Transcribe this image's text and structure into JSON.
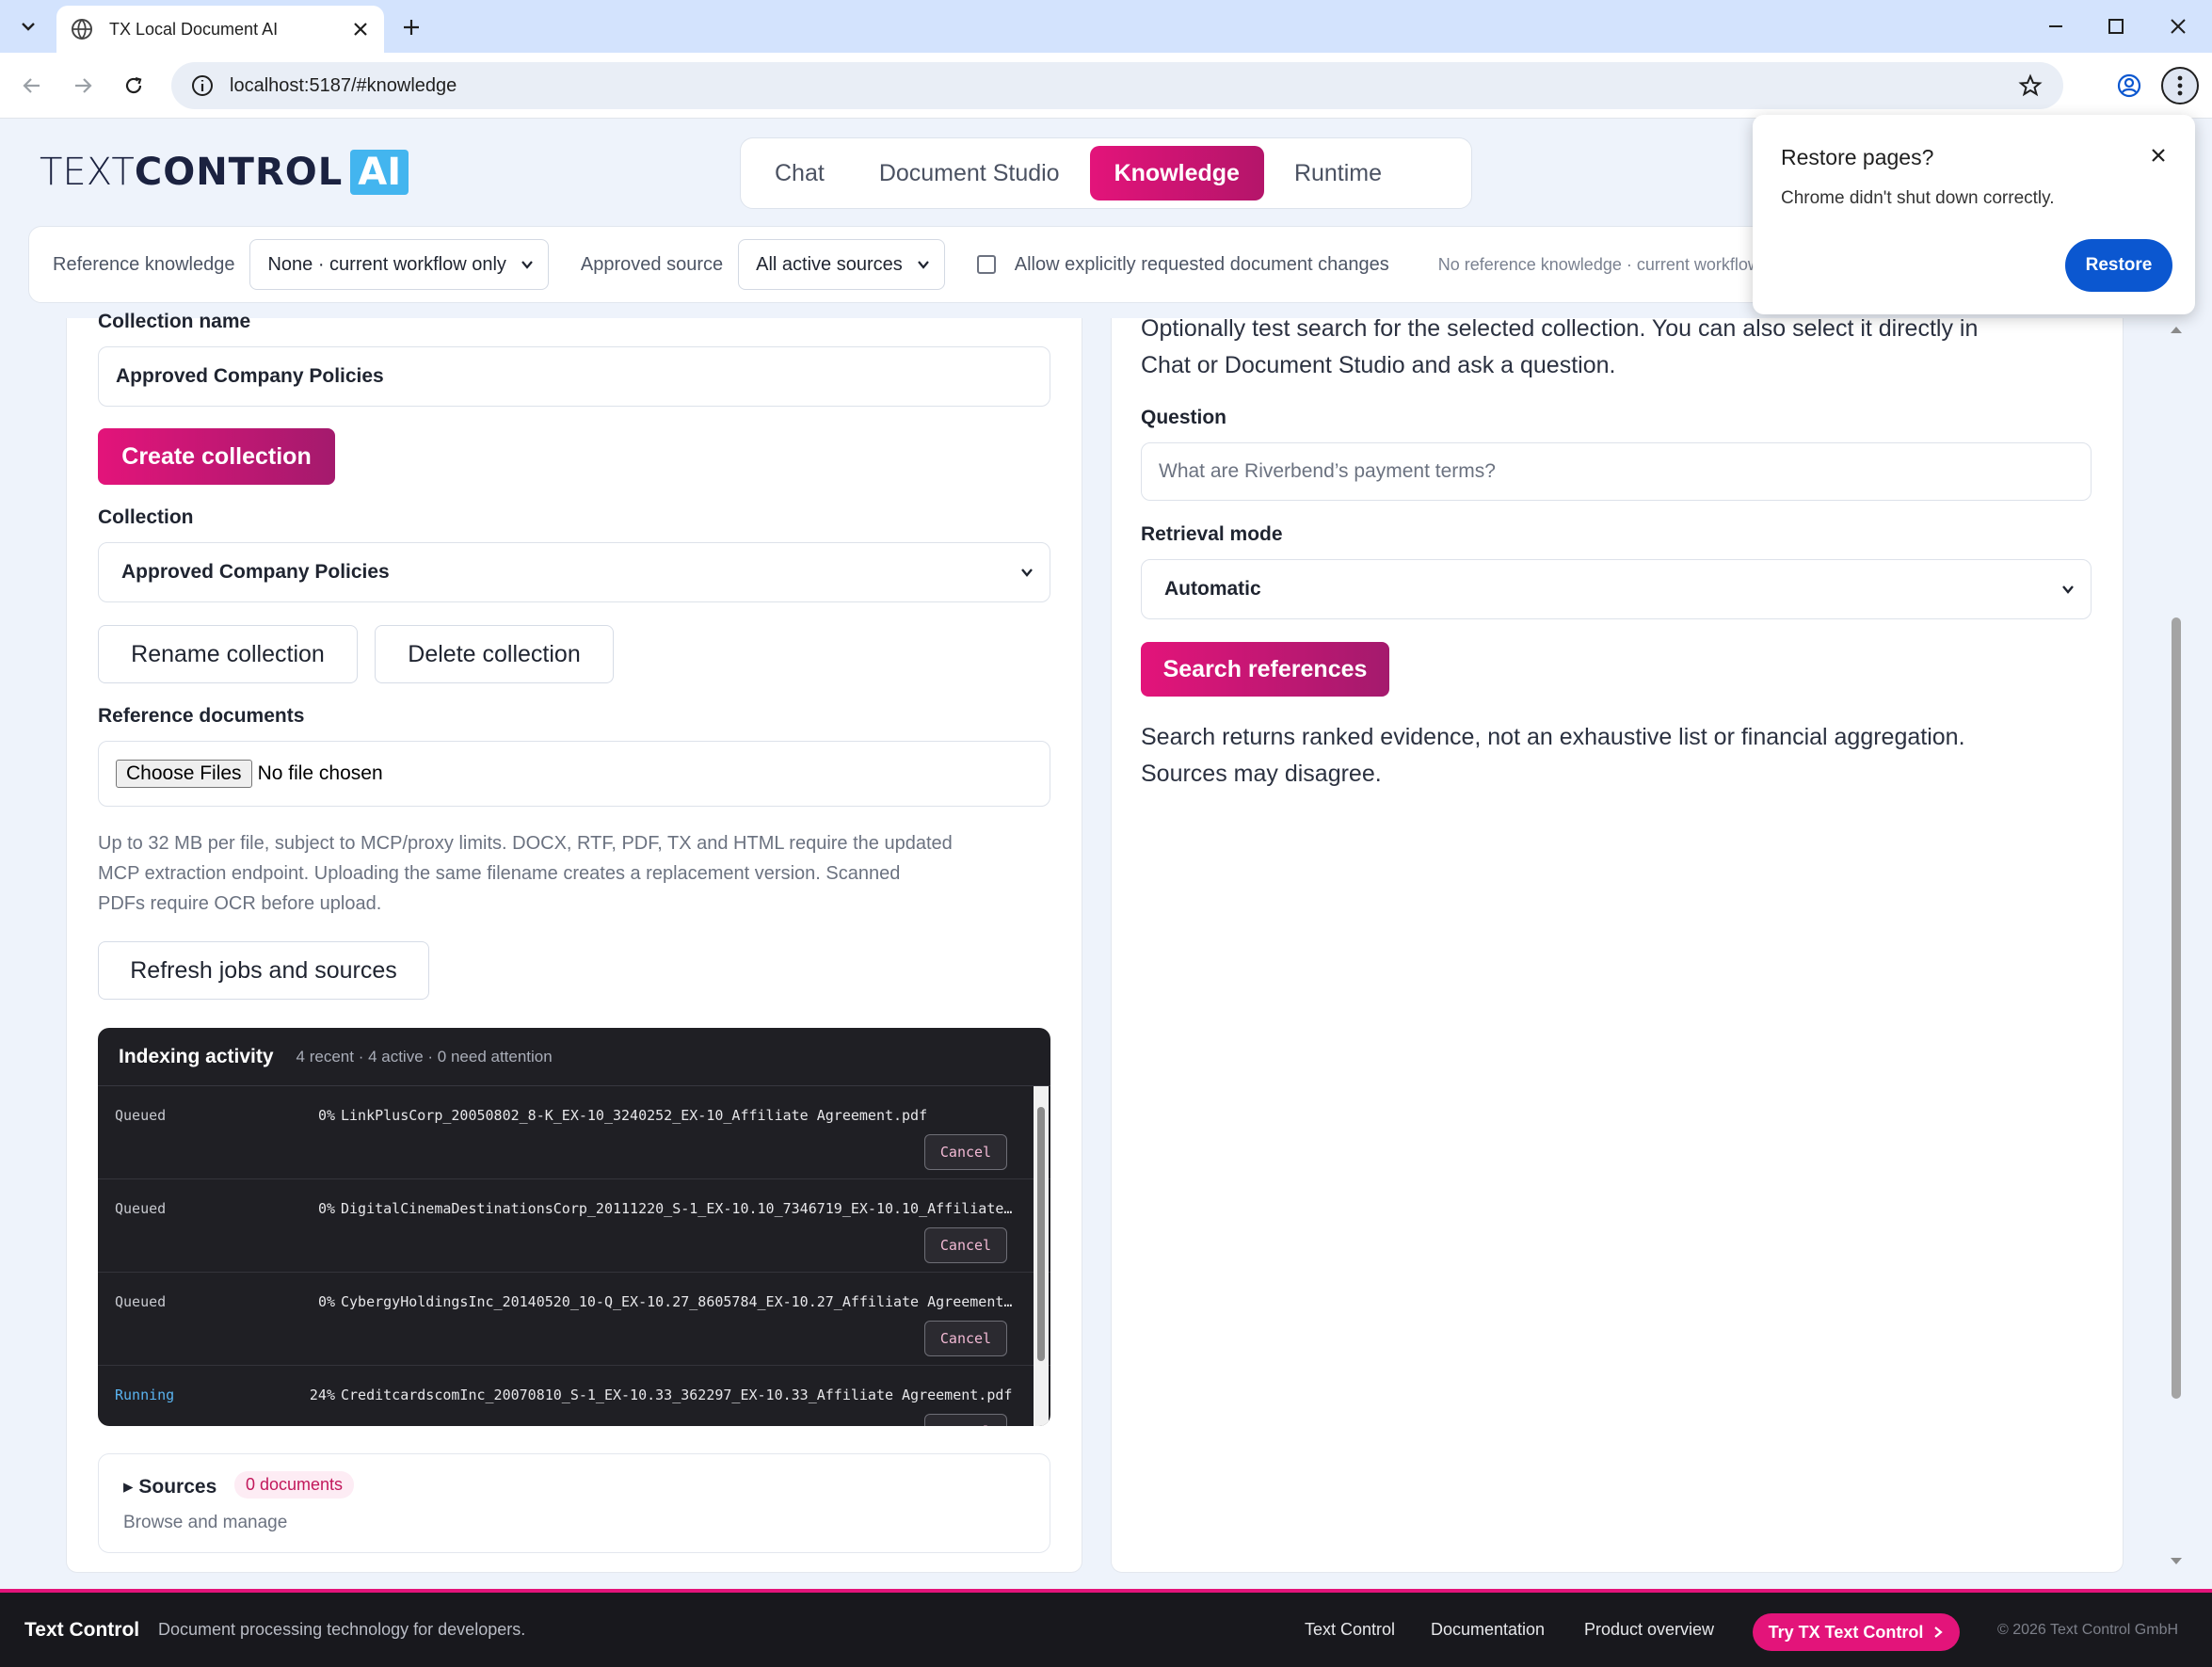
{
  "browser": {
    "tab_title": "TX Local Document AI",
    "url": "localhost:5187/#knowledge"
  },
  "popup": {
    "title": "Restore pages?",
    "text": "Chrome didn't shut down correctly.",
    "button": "Restore"
  },
  "header": {
    "logo_text1": "TEXT",
    "logo_text2": "CONTROL",
    "logo_ai": "AI",
    "tabs": [
      {
        "label": "Chat",
        "active": false
      },
      {
        "label": "Document Studio",
        "active": false
      },
      {
        "label": "Knowledge",
        "active": true
      },
      {
        "label": "Runtime",
        "active": false
      }
    ]
  },
  "settings": {
    "ref_label": "Reference knowledge",
    "ref_value": "None · current workflow only",
    "source_label": "Approved source",
    "source_value": "All active sources",
    "allow_label": "Allow explicitly requested document changes",
    "status": "No reference knowledge · current workflow only"
  },
  "left": {
    "collection_name_label": "Collection name",
    "collection_name_value": "Approved Company Policies",
    "create_button": "Create collection",
    "collection_label": "Collection",
    "collection_value": "Approved Company Policies",
    "rename_button": "Rename collection",
    "delete_button": "Delete collection",
    "ref_docs_label": "Reference documents",
    "choose_files": "Choose Files",
    "no_file": "No file chosen",
    "help_line1": "Up to 32 MB per file, subject to MCP/proxy limits. DOCX, RTF, PDF, TX and HTML require the updated",
    "help_line2": "MCP extraction endpoint. Uploading the same filename creates a replacement version. Scanned",
    "help_line3": "PDFs require OCR before upload.",
    "refresh_button": "Refresh jobs and sources",
    "activity": {
      "title": "Indexing activity",
      "meta": "4 recent · 4 active · 0 need attention",
      "cancel_label": "Cancel",
      "jobs": [
        {
          "status": "Queued",
          "pct": "0%",
          "file": "LinkPlusCorp_20050802_8-K_EX-10_3240252_EX-10_Affiliate Agreement.pdf"
        },
        {
          "status": "Queued",
          "pct": "0%",
          "file": "DigitalCinemaDestinationsCorp_20111220_S-1_EX-10.10_7346719_EX-10.10_Affiliate Agreement.pdf"
        },
        {
          "status": "Queued",
          "pct": "0%",
          "file": "CybergyHoldingsInc_20140520_10-Q_EX-10.27_8605784_EX-10.27_Affiliate Agreement.pdf"
        },
        {
          "status": "Running",
          "pct": "24%",
          "file": "CreditcardscomInc_20070810_S-1_EX-10.33_362297_EX-10.33_Affiliate Agreement.pdf"
        }
      ]
    },
    "sources": {
      "title": "Sources",
      "badge": "0 documents",
      "sub": "Browse and manage"
    }
  },
  "right": {
    "intro_line1": "Optionally test search for the selected collection. You can also select it directly in",
    "intro_line2": "Chat or Document Studio and ask a question.",
    "question_label": "Question",
    "question_placeholder": "What are Riverbend’s payment terms?",
    "mode_label": "Retrieval mode",
    "mode_value": "Automatic",
    "search_button": "Search references",
    "note_line1": "Search returns ranked evidence, not an exhaustive list or financial aggregation.",
    "note_line2": "Sources may disagree."
  },
  "footer": {
    "brand": "Text Control",
    "tagline": "Document processing technology for developers.",
    "links": [
      "Text Control",
      "Documentation",
      "Product overview"
    ],
    "try_button": "Try TX Text Control",
    "copyright": "© 2026 Text Control GmbH"
  },
  "colors": {
    "accent": "#e3147a",
    "chrome_blue": "#0b57d0",
    "logo_ai": "#43b5ef"
  }
}
